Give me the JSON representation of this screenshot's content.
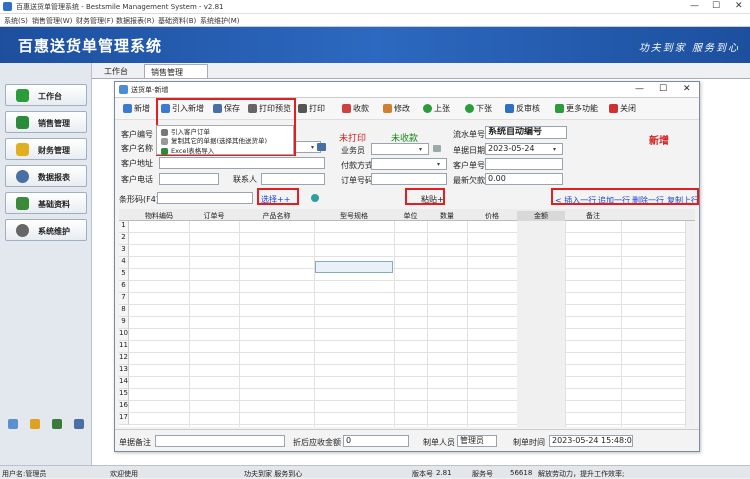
{
  "window": {
    "title": "百惠送货单管理系统 - Bestsmile Management System - v2.81"
  },
  "menu": [
    "系统(S)",
    "销售管理(W)",
    "财务管理(F)",
    "数据报表(R)",
    "基础资料(B)",
    "系统维护(M)"
  ],
  "banner": {
    "title": "百惠送货单管理系统",
    "slogan": "功夫到家 服务到心"
  },
  "sidebar": [
    {
      "label": "工作台",
      "icon": "desk-icon",
      "color": "#2a9d3a"
    },
    {
      "label": "销售管理",
      "icon": "sales-icon",
      "color": "#2c8a3c"
    },
    {
      "label": "财务管理",
      "icon": "folder-icon",
      "color": "#e0b020"
    },
    {
      "label": "数据报表",
      "icon": "search-icon",
      "color": "#4a6fa5"
    },
    {
      "label": "基础资料",
      "icon": "data-icon",
      "color": "#3a8a3a"
    },
    {
      "label": "系统维护",
      "icon": "gear-icon",
      "color": "#666666"
    }
  ],
  "tabs": [
    "工作台",
    "销售管理"
  ],
  "dialog": {
    "title": "送货单-新增",
    "toolbar": [
      "新增",
      "引入新增",
      "保存",
      "打印预览",
      "打印",
      "收款",
      "修改",
      "上张",
      "下张",
      "反审核",
      "更多功能",
      "关闭"
    ],
    "dropdown": [
      "引入客户订单",
      "复制其它的单据(选择其他送货单)",
      "Excel表格导入"
    ],
    "status": {
      "print": "未打印",
      "pay": "未收款",
      "mode": "新增"
    },
    "labels": {
      "customer_code": "客户编号",
      "customer_name": "客户名称",
      "customer_addr": "客户地址",
      "customer_phone": "客户电话",
      "contact": "联系人",
      "salesman": "业务员",
      "pay_method": "付款方式",
      "order_no": "订单号码",
      "serial": "流水单号",
      "date": "单据日期",
      "cust_order": "客户单号",
      "latest_debt": "最新欠款",
      "barcode": "条形码(F4)"
    },
    "values": {
      "serial": "系统自动编号",
      "date": "2023-05-24",
      "latest_debt": "0.00"
    },
    "actions": {
      "select": "选择++",
      "paste": "粘贴+",
      "insert": "< 插入一行",
      "append": "追加一行",
      "delete": "删除一行",
      "copy": "复制上行"
    },
    "grid": {
      "columns": [
        "物料编码",
        "订单号",
        "产品名称",
        "型号规格",
        "单位",
        "数量",
        "价格",
        "金额",
        "备注"
      ],
      "rows": [
        "1",
        "2",
        "3",
        "4",
        "5",
        "6",
        "7",
        "8",
        "9",
        "10",
        "11",
        "12",
        "13",
        "14",
        "15",
        "16",
        "17"
      ]
    },
    "footer": {
      "remark_label": "单据备注",
      "discount_label": "折后应收金额",
      "discount_value": "0",
      "maker_label": "制单人员",
      "maker_value": "管理员",
      "time_label": "制单时间",
      "time_value": "2023-05-24 15:48:09"
    }
  },
  "statusbar": {
    "user": "用户名:管理员",
    "welcome": "欢迎使用",
    "motto": "功夫到家 服务到心",
    "version_label": "版本号",
    "version": "2.81",
    "service_label": "服务号",
    "service": "56618",
    "tip": "解放劳动力，提升工作效率;"
  }
}
